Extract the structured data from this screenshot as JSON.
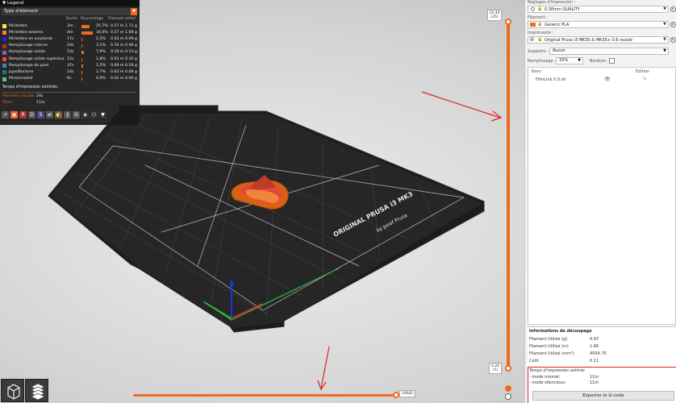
{
  "legend": {
    "title": "Legend",
    "view_type": "Type d'élément",
    "columns": {
      "duration": "Durée",
      "percent": "Pourcentage",
      "filament": "Filament utilisé"
    },
    "rows": [
      {
        "name": "Périmètre",
        "color": "#ffe64d",
        "duration": "3m",
        "percent": "25,7%",
        "fraction": 0.257,
        "length": "0.57 m",
        "weight": "1.71 g"
      },
      {
        "name": "Périmètre externe",
        "color": "#ff7d38",
        "duration": "4m",
        "percent": "34,6%",
        "fraction": 0.346,
        "length": "0.57 m",
        "weight": "1.69 g"
      },
      {
        "name": "Périmètre en surplomb",
        "color": "#1f1fff",
        "duration": "17s",
        "percent": "2,5%",
        "fraction": 0.025,
        "length": "0.03 m",
        "weight": "0.09 g"
      },
      {
        "name": "Remplissage interne",
        "color": "#b03029",
        "duration": "24s",
        "percent": "3,1%",
        "fraction": 0.031,
        "length": "0.16 m",
        "weight": "0.46 g"
      },
      {
        "name": "Remplissage solide",
        "color": "#9654cc",
        "duration": "53s",
        "percent": "7,9%",
        "fraction": 0.079,
        "length": "0.18 m",
        "weight": "0.53 g"
      },
      {
        "name": "Remplissage solide supérieur",
        "color": "#f04040",
        "duration": "12s",
        "percent": "1,8%",
        "fraction": 0.018,
        "length": "0.03 m",
        "weight": "0.10 g"
      },
      {
        "name": "Remplissage du pont",
        "color": "#4d80ba",
        "duration": "37s",
        "percent": "5,5%",
        "fraction": 0.055,
        "length": "0.09 m",
        "weight": "0.29 g"
      },
      {
        "name": "Jupe/Bordure",
        "color": "#00876e",
        "duration": "14s",
        "percent": "2,7%",
        "fraction": 0.027,
        "length": "0.03 m",
        "weight": "0.09 g"
      },
      {
        "name": "Personnalisé",
        "color": "#5ebd7a",
        "duration": "6s",
        "percent": "0,9%",
        "fraction": 0.009,
        "length": "0.02 m",
        "weight": "0.06 g"
      }
    ],
    "estimated_label": "Temps d'impression estimés:",
    "first_layer_label": "Première couche:",
    "first_layer_value": "24s",
    "total_label": "Total:",
    "total_value": "11m"
  },
  "sidebar": {
    "print_settings_label": "Réglages d'impression :",
    "print_settings_value": "0.30mm QUALITY",
    "filament_label": "Filament :",
    "filament_value": "Generic PLA",
    "printer_label": "Imprimante :",
    "printer_value": "Original Prusa i3 MK3S & MK3S+ 0.6 nozzle",
    "supports_label": "Supports :",
    "supports_value": "Aucun",
    "infill_label": "Remplissage :",
    "infill_value": "15%",
    "brim_label": "Bordure :",
    "object_list": {
      "col_name": "Nom",
      "col_edit": "Édition",
      "items": [
        {
          "name": "FilmLink 5.0.stl"
        }
      ]
    },
    "slice_info": {
      "title": "Informations de découpage",
      "rows": [
        {
          "label": "Filament Utilisé (g)",
          "value": "4.97"
        },
        {
          "label": "Filament Utilisé (m)",
          "value": "1.66"
        },
        {
          "label": "Filament Utilisé (mm³)",
          "value": "4004.70"
        },
        {
          "label": "Coût",
          "value": "0.11"
        }
      ],
      "estimated_label": "Temps d'impression estimé:",
      "normal_label": "- mode normal:",
      "normal_value": "11m",
      "silent_label": "- mode silencieux:",
      "silent_value": "11m"
    },
    "export_button": "Exporter le G-code",
    "accent_color": "#ed6b21",
    "highlight_color": "#d9262c"
  },
  "vertical_slider": {
    "top_height": "10.40",
    "top_layer": "(35)",
    "bottom_height": "0.20",
    "bottom_layer": "(1)"
  },
  "horizontal_slider": {
    "value": "10682"
  },
  "bed": {
    "brand_line1": "ORIGINAL PRUSA i3 MK3",
    "brand_line2": "by Josef Prusa"
  }
}
